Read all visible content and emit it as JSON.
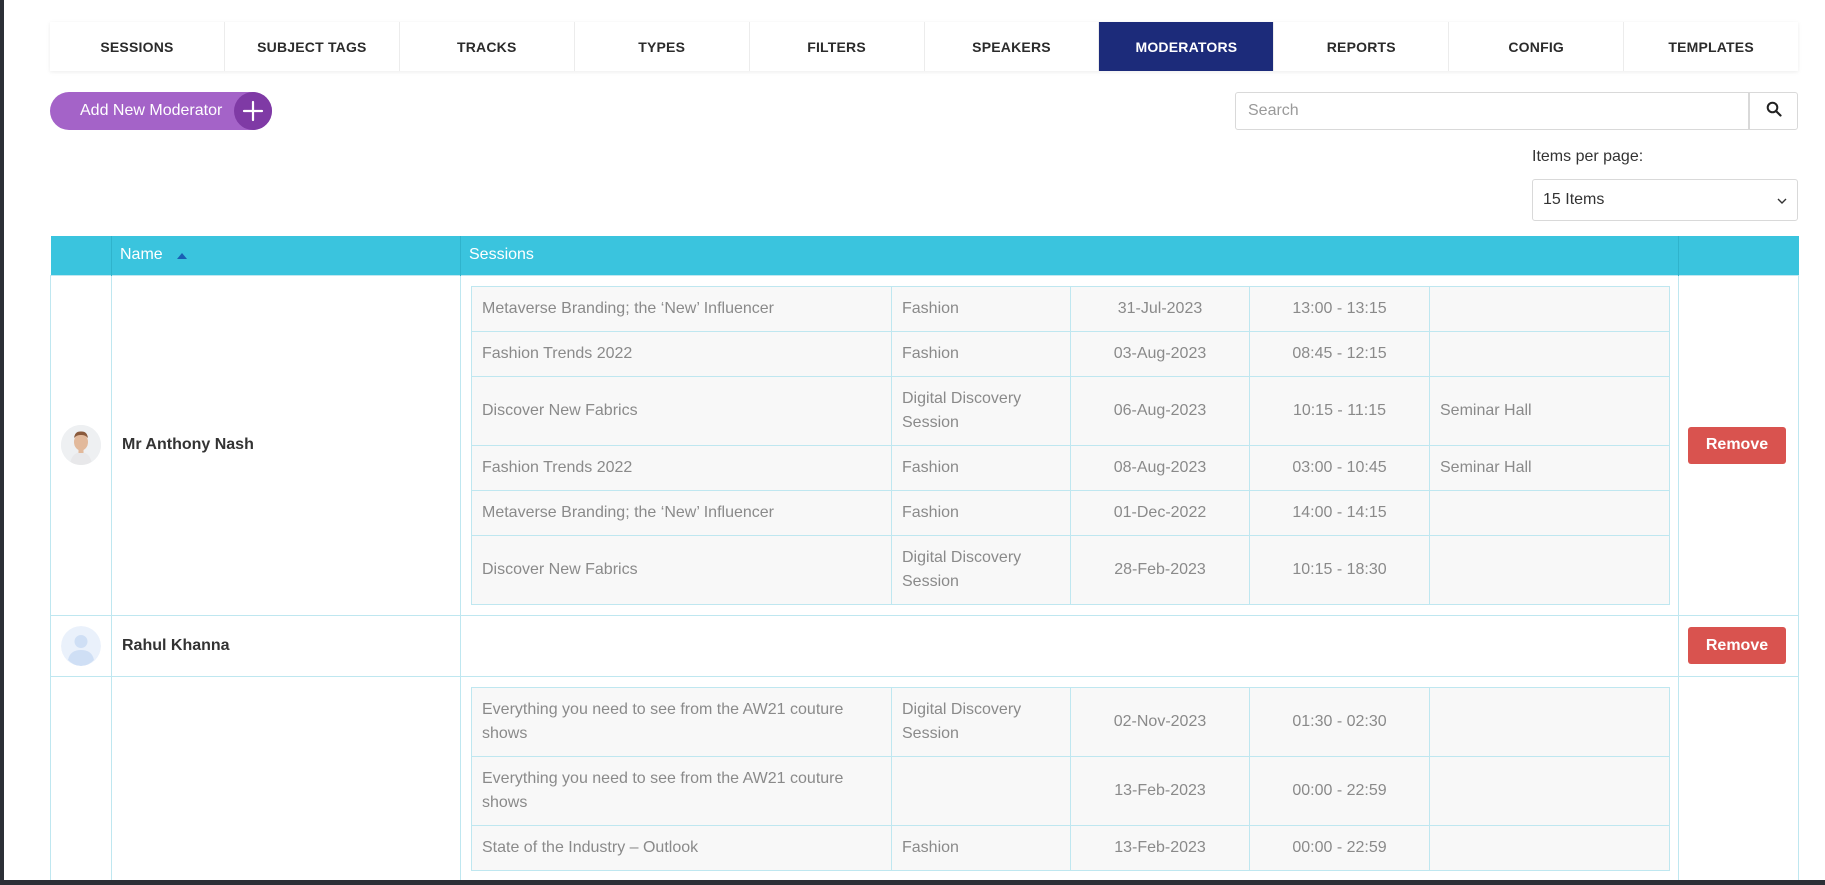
{
  "tabs": [
    {
      "label": "SESSIONS",
      "active": false
    },
    {
      "label": "SUBJECT TAGS",
      "active": false
    },
    {
      "label": "TRACKS",
      "active": false
    },
    {
      "label": "TYPES",
      "active": false
    },
    {
      "label": "FILTERS",
      "active": false
    },
    {
      "label": "SPEAKERS",
      "active": false
    },
    {
      "label": "MODERATORS",
      "active": true
    },
    {
      "label": "REPORTS",
      "active": false
    },
    {
      "label": "CONFIG",
      "active": false
    },
    {
      "label": "TEMPLATES",
      "active": false
    }
  ],
  "toolbar": {
    "add_label": "Add New Moderator",
    "add_icon": "plus-icon",
    "search_placeholder": "Search",
    "search_icon": "search-icon"
  },
  "pagination": {
    "items_per_page_label": "Items per page:",
    "items_per_page_value": "15 Items"
  },
  "colors": {
    "active_tab": "#1c2b7a",
    "table_header": "#3ac4de",
    "add_button": "#a463c8",
    "remove_button": "#d9534f"
  },
  "table": {
    "headers": {
      "name": "Name",
      "sessions": "Sessions"
    },
    "remove_label": "Remove",
    "moderators": [
      {
        "name": "Mr Anthony Nash",
        "avatar": "photo",
        "sessions": [
          {
            "title": "Metaverse Branding; the ‘New’ Influencer",
            "track": "Fashion",
            "date": "31-Jul-2023",
            "time": "13:00 - 13:15",
            "location": ""
          },
          {
            "title": "Fashion Trends 2022",
            "track": "Fashion",
            "date": "03-Aug-2023",
            "time": "08:45 - 12:15",
            "location": ""
          },
          {
            "title": "Discover New Fabrics",
            "track": "Digital Discovery Session",
            "date": "06-Aug-2023",
            "time": "10:15 - 11:15",
            "location": "Seminar Hall"
          },
          {
            "title": "Fashion Trends 2022",
            "track": "Fashion",
            "date": "08-Aug-2023",
            "time": "03:00 - 10:45",
            "location": "Seminar Hall"
          },
          {
            "title": "Metaverse Branding; the ‘New’ Influencer",
            "track": "Fashion",
            "date": "01-Dec-2022",
            "time": "14:00 - 14:15",
            "location": ""
          },
          {
            "title": "Discover New Fabrics",
            "track": "Digital Discovery Session",
            "date": "28-Feb-2023",
            "time": "10:15 - 18:30",
            "location": ""
          }
        ]
      },
      {
        "name": "Rahul Khanna",
        "avatar": "placeholder",
        "sessions": []
      },
      {
        "name": "",
        "avatar": "none",
        "sessions": [
          {
            "title": "Everything you need to see from the AW21 couture shows",
            "track": "Digital Discovery Session",
            "date": "02-Nov-2023",
            "time": "01:30 - 02:30",
            "location": ""
          },
          {
            "title": "Everything you need to see from the AW21 couture shows",
            "track": "",
            "date": "13-Feb-2023",
            "time": "00:00 - 22:59",
            "location": ""
          },
          {
            "title": "State of the Industry – Outlook",
            "track": "Fashion",
            "date": "13-Feb-2023",
            "time": "00:00 - 22:59",
            "location": ""
          }
        ]
      }
    ]
  }
}
